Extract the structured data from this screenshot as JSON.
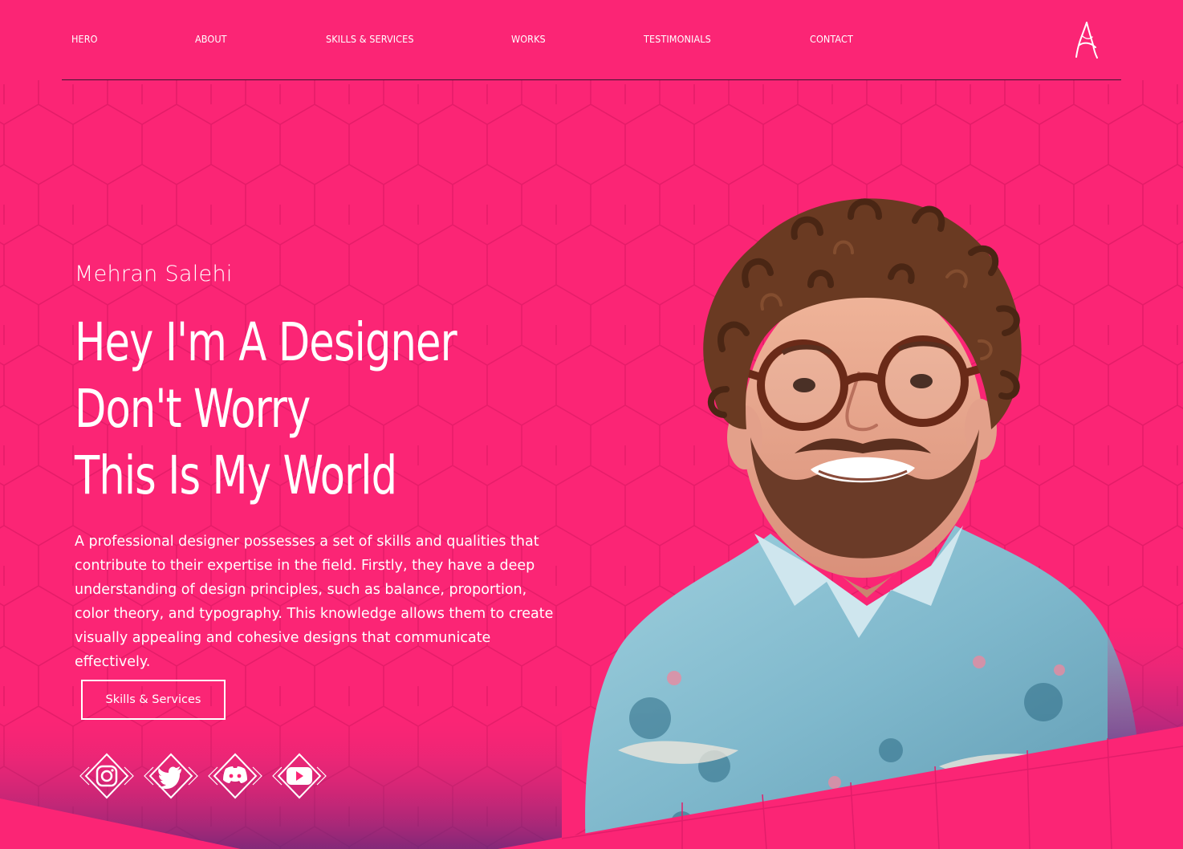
{
  "nav": {
    "items": [
      {
        "label": "HERO"
      },
      {
        "label": "ABOUT"
      },
      {
        "label": "SKILLS & SERVICES"
      },
      {
        "label": "WORKS"
      },
      {
        "label": "TESTIMONIALS"
      },
      {
        "label": "CONTACT"
      }
    ],
    "logo_icon": "a-monogram-logo-icon"
  },
  "hero": {
    "name": "Mehran Salehi",
    "title_lines": [
      "Hey I'm A Designer",
      "Don't Worry",
      "This Is My World"
    ],
    "description": "A professional designer possesses a set of skills and qualities that contribute to their expertise in the field. Firstly, they have a deep understanding of design principles, such as balance, proportion, color theory, and typography. This knowledge allows them to create visually appealing and cohesive designs that communicate effectively.",
    "cta_label": "Skills & Services"
  },
  "social": [
    {
      "icon": "instagram-icon"
    },
    {
      "icon": "twitter-icon"
    },
    {
      "icon": "discord-icon"
    },
    {
      "icon": "youtube-icon"
    }
  ],
  "colors": {
    "background": "#fb2575",
    "bottom_shadow": "#5a2a7a",
    "text": "#ffffff"
  }
}
